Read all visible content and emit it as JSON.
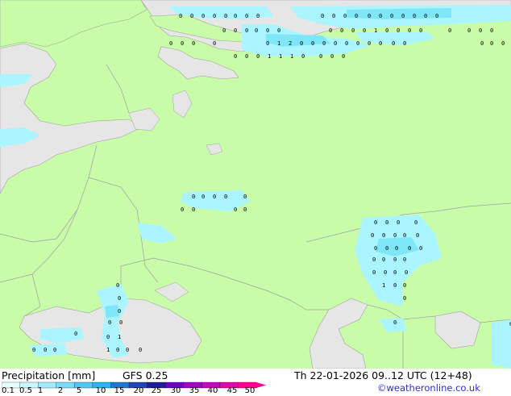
{
  "map": {
    "colors": {
      "land": "#c8fca8",
      "water": "#e6e6e6",
      "precip_light": "#aaf5ff",
      "precip_mid": "#7fe6f7",
      "border": "#a0a0a0",
      "coast": "#a0a0a0"
    },
    "precip_points": [
      "0",
      "0",
      "0",
      "0",
      "0",
      "0",
      "0",
      "0",
      "0",
      "0",
      "0",
      "0",
      "0",
      "0",
      "0",
      "0",
      "0",
      "0",
      "0",
      "0",
      "0",
      "0",
      "0",
      "0",
      "0",
      "0",
      "0",
      "0",
      "0",
      "1",
      "0",
      "0",
      "0",
      "0",
      "0",
      "0",
      "0",
      "0",
      "0",
      "0",
      "0",
      "0",
      "0",
      "1",
      "2",
      "0",
      "0",
      "0",
      "0",
      "0",
      "0",
      "0",
      "0",
      "0",
      "0",
      "0",
      "0",
      "0",
      "0",
      "0",
      "0",
      "1",
      "1",
      "1",
      "0",
      "0",
      "0",
      "0",
      "0",
      "0",
      "0",
      "0",
      "0",
      "0",
      "0",
      "0",
      "0",
      "0",
      "0",
      "0",
      "0",
      "0",
      "0",
      "0",
      "0",
      "0",
      "0",
      "0",
      "0",
      "0",
      "0",
      "0",
      "0",
      "0",
      "0",
      "0",
      "0",
      "0",
      "0",
      "1",
      "0",
      "0",
      "0",
      "0",
      "0",
      "0",
      "0",
      "0",
      "0",
      "0",
      "1",
      "0",
      "0",
      "0",
      "1",
      "0",
      "0",
      "0",
      "0",
      "0",
      "0",
      "0"
    ]
  },
  "footer": {
    "product": "Precipitation [mm]",
    "model": "GFS 0.25",
    "valid": "Th 22-01-2026 09..12 UTC (12+48)",
    "credit": "©weatheronline.co.uk"
  },
  "legend": {
    "ticks": [
      "0.1",
      "0.5",
      "1",
      "2",
      "5",
      "10",
      "15",
      "20",
      "25",
      "30",
      "35",
      "40",
      "45",
      "50"
    ],
    "colors": [
      "#e8ffff",
      "#c8f8ff",
      "#a0ecff",
      "#78dcfa",
      "#50c8f5",
      "#28b4f0",
      "#1e78d2",
      "#1e46b4",
      "#1e1e96",
      "#6e00c8",
      "#a000c8",
      "#c800c8",
      "#e600aa",
      "#ff0096"
    ]
  }
}
